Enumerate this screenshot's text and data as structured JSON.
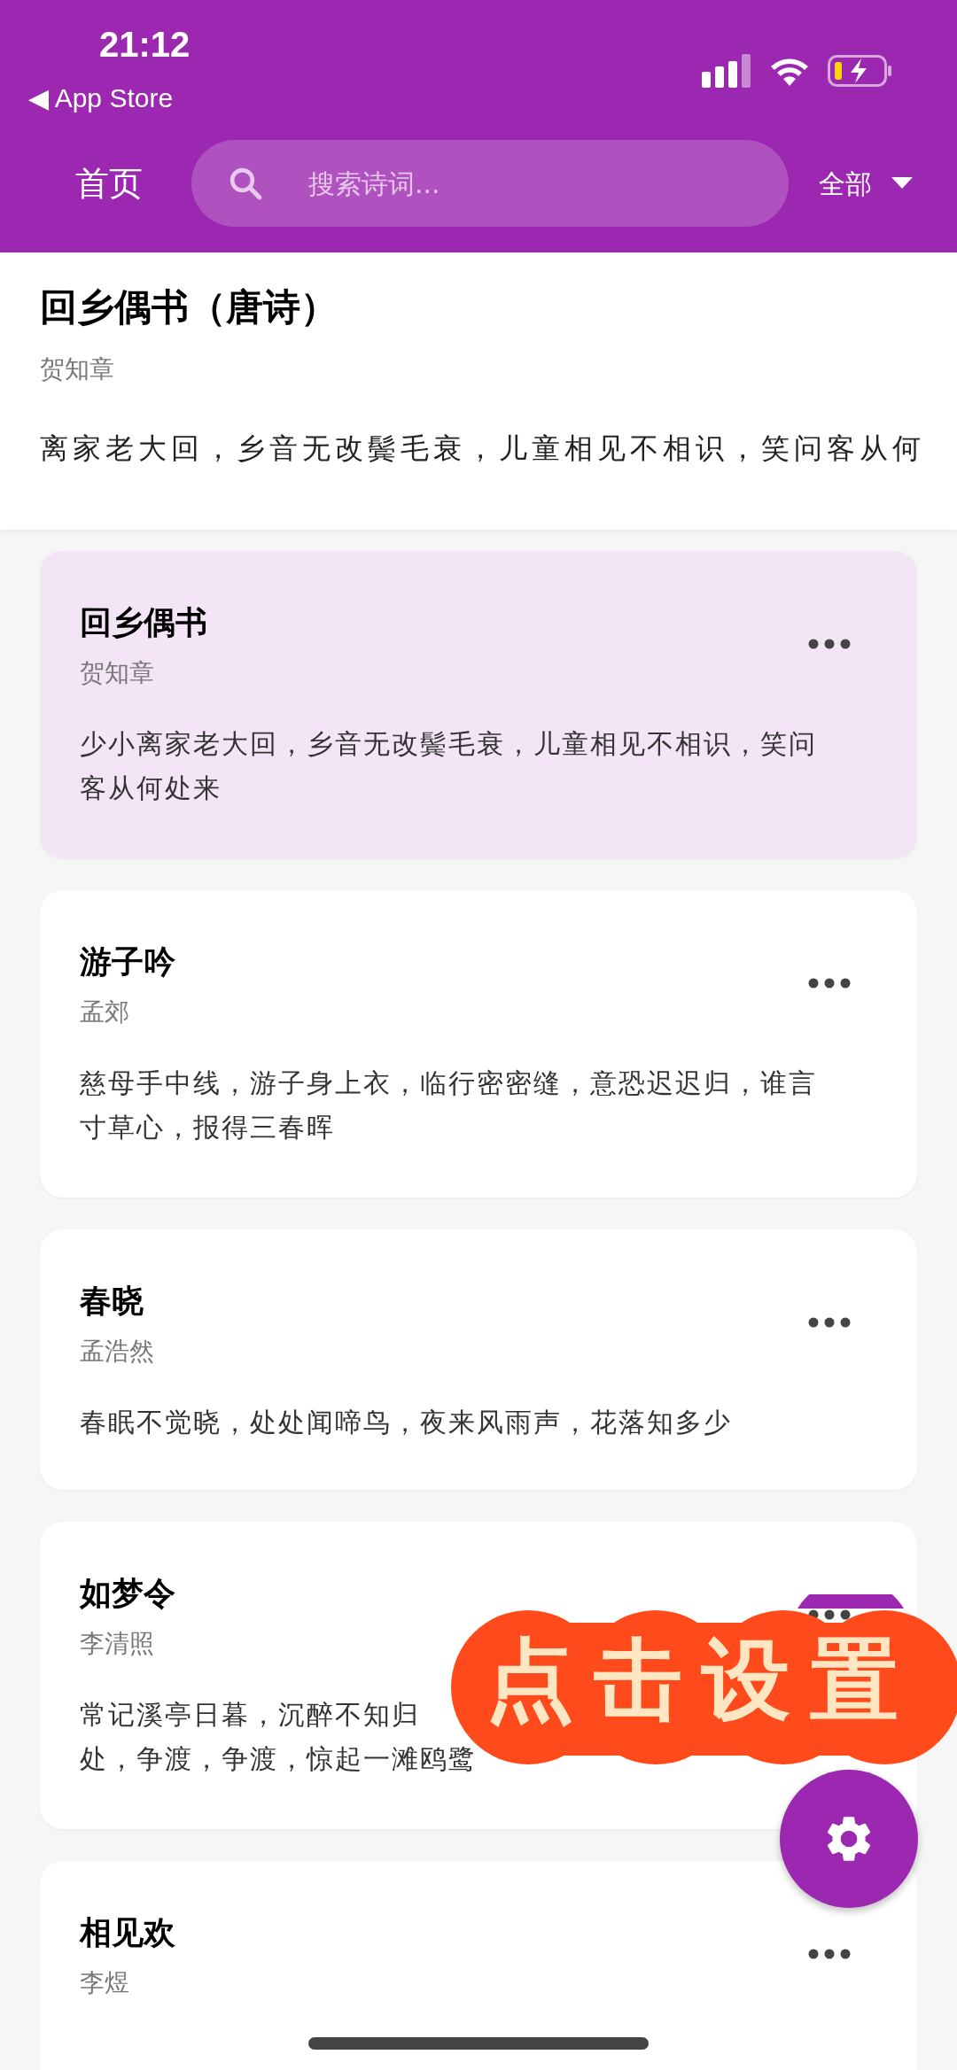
{
  "status_bar": {
    "time": "21:12",
    "back_label": "◀ App Store"
  },
  "nav": {
    "title": "首页",
    "search": {
      "placeholder": "搜索诗词..."
    },
    "filter": "全部"
  },
  "detail": {
    "title": "回乡偶书（唐诗）",
    "author": "贺知章",
    "text": "离家老大回，乡音无改鬓毛衰，儿童相见不相识，笑问客从何"
  },
  "poems": [
    {
      "title": "回乡偶书",
      "author": "贺知章",
      "lines": [
        "少小离家老大回，乡音无改鬓毛衰，儿童相见不相识，笑问",
        "客从何处来"
      ],
      "selected": true
    },
    {
      "title": "游子吟",
      "author": "孟郊",
      "lines": [
        "慈母手中线，游子身上衣，临行密密缝，意恐迟迟归，谁言",
        "寸草心，报得三春晖"
      ],
      "selected": false
    },
    {
      "title": "春晓",
      "author": "孟浩然",
      "lines": [
        "春眠不觉晓，处处闻啼鸟，夜来风雨声，花落知多少"
      ],
      "selected": false
    },
    {
      "title": "如梦令",
      "author": "李清照",
      "lines": [
        "常记溪亭日暮，沉醉不知归",
        "处，争渡，争渡，惊起一滩鸥鹭"
      ],
      "selected": false
    },
    {
      "title": "相见欢",
      "author": "李煜",
      "selected": false
    }
  ],
  "overlay": {
    "label": "点击设置"
  }
}
